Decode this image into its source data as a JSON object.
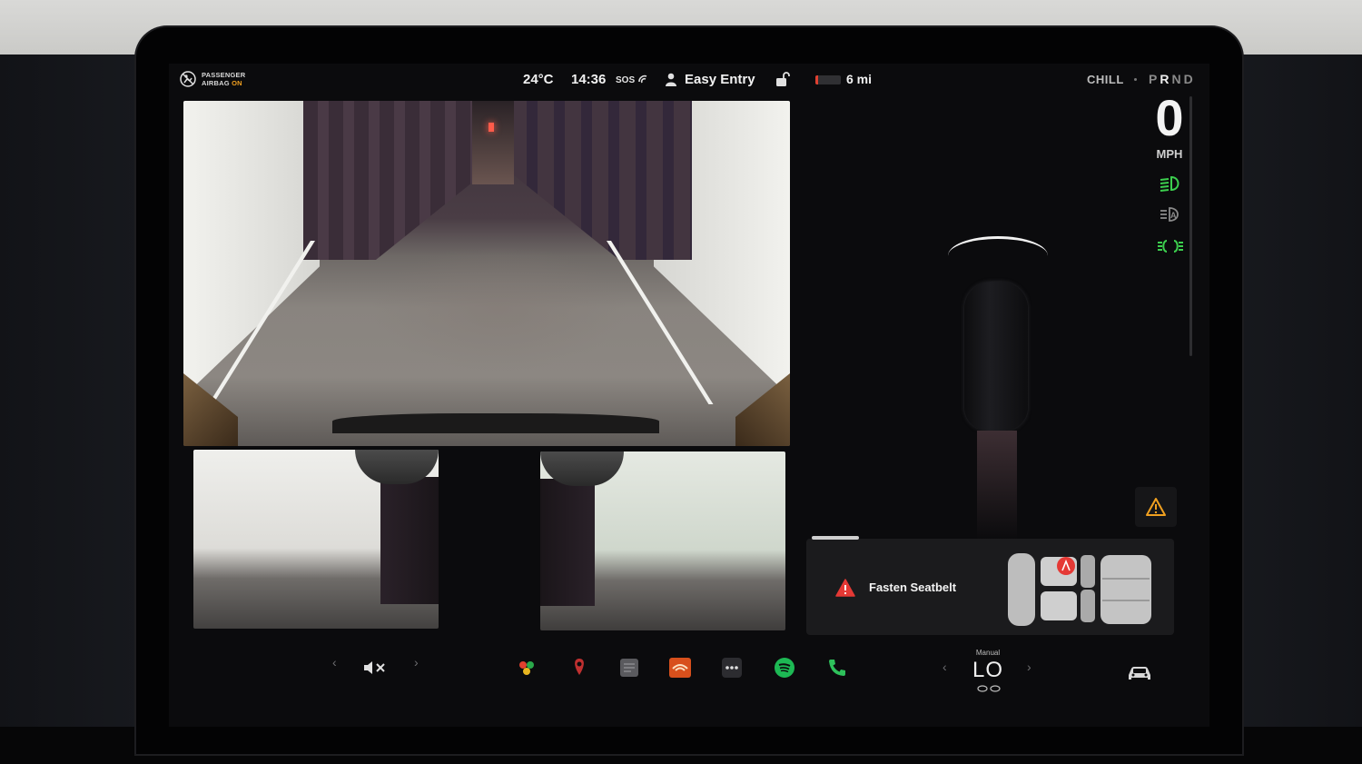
{
  "status_bar": {
    "airbag_line1": "PASSENGER",
    "airbag_line2": "AIRBAG",
    "airbag_state": "ON",
    "temperature": "24°C",
    "time": "14:36",
    "sos": "SOS",
    "profile_name": "Easy Entry",
    "range": "6 mi",
    "drive_mode": "CHILL",
    "gears": [
      "P",
      "R",
      "N",
      "D"
    ],
    "active_gear": "R"
  },
  "cameras": {
    "views": [
      "rear-camera",
      "left-repeater-camera",
      "right-repeater-camera"
    ]
  },
  "instrument": {
    "speed": "0",
    "speed_unit": "MPH",
    "lights": [
      {
        "icon": "low-beam-icon",
        "color": "#3ccf4e"
      },
      {
        "icon": "auto-high-beam-icon",
        "color": "#8a8a8a"
      },
      {
        "icon": "parking-lights-icon",
        "color": "#3ccf4e"
      }
    ]
  },
  "alert": {
    "message": "Fasten Seatbelt",
    "icon": "warning-triangle-icon",
    "color": "#e53935"
  },
  "dock": {
    "volume_icon": "mute-icon",
    "apps": [
      "toybox-icon",
      "navigation-icon",
      "notes-icon",
      "audible-icon",
      "more-icon",
      "spotify-icon",
      "phone-icon"
    ],
    "climate_label": "Manual",
    "climate_value": "LO",
    "car_icon": "car-icon"
  },
  "colors": {
    "accent_green": "#3ccf4e",
    "warning_amber": "#f0a020",
    "alert_red": "#e53935"
  }
}
